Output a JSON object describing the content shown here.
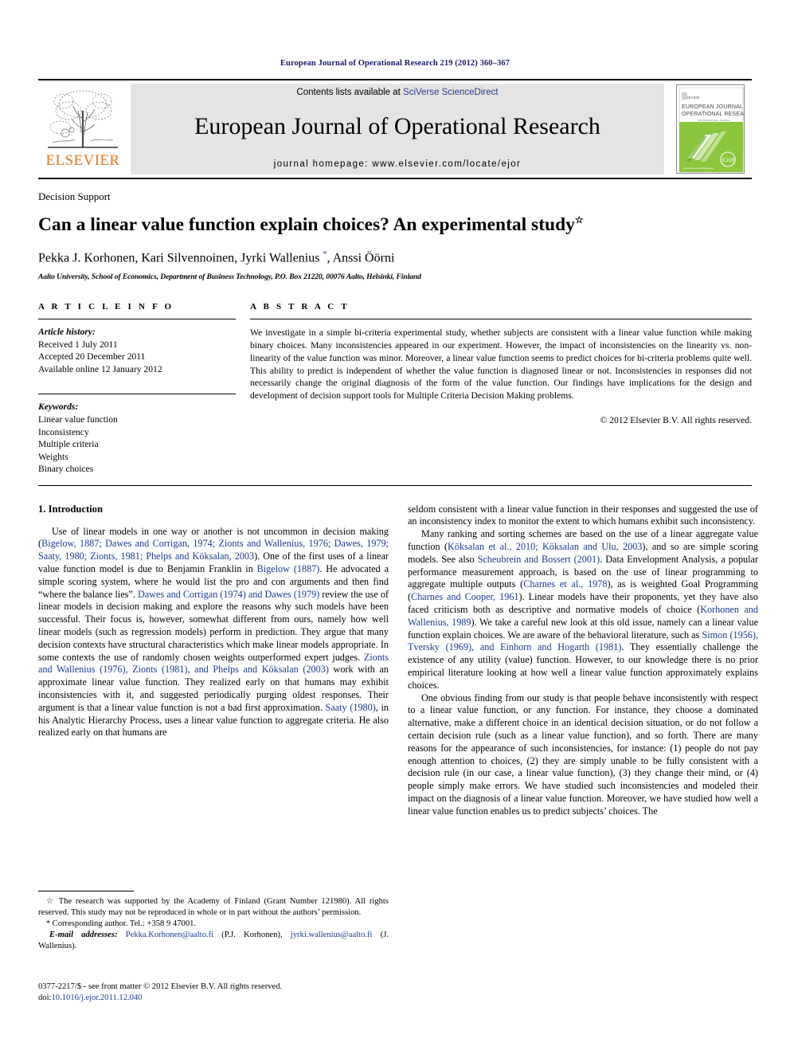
{
  "running_head": "European Journal of Operational Research 219 (2012) 360–367",
  "masthead": {
    "publisher_logo_label": "ELSEVIER",
    "contents_prefix": "Contents lists available at ",
    "contents_link": "SciVerse ScienceDirect",
    "journal_title": "European Journal of Operational Research",
    "homepage_line": "journal homepage: www.elsevier.com/locate/ejor",
    "cover_title_line1": "EUROPEAN  JOURNAL  OF",
    "cover_title_line2": "OPERATIONAL  RESEARCH",
    "cover_url": "www.elsevier.com/locate/ejor",
    "cover_badge": "EJOR",
    "accent_green": "#8cc63e",
    "accent_orange": "#E87722",
    "link_blue": "#1a3a8f"
  },
  "article": {
    "section_tag": "Decision Support",
    "title": "Can a linear value function explain choices? An experimental study",
    "title_mark": "☆",
    "authors": "Pekka J. Korhonen, Kari Silvennoinen, Jyrki Wallenius ",
    "corresponding_mark": "*",
    "authors_tail": ", Anssi Öörni",
    "affiliation": "Aalto University, School of Economics, Department of Business Technology, P.O. Box 21220, 00076 Aalto, Helsinki, Finland"
  },
  "article_info": {
    "heading": "A R T I C L E  I N F O",
    "history_label": "Article history:",
    "history": [
      "Received 1 July 2011",
      "Accepted 20 December 2011",
      "Available online 12 January 2012"
    ],
    "keywords_label": "Keywords:",
    "keywords": [
      "Linear value function",
      "Inconsistency",
      "Multiple criteria",
      "Weights",
      "Binary choices"
    ]
  },
  "abstract": {
    "heading": "A B S T R A C T",
    "text": "We investigate in a simple bi-criteria experimental study, whether subjects are consistent with a linear value function while making binary choices. Many inconsistencies appeared in our experiment. However, the impact of inconsistencies on the linearity vs. non-linearity of the value function was minor. Moreover, a linear value function seems to predict choices for bi-criteria problems quite well. This ability to predict is independent of whether the value function is diagnosed linear or not. Inconsistencies in responses did not necessarily change the original diagnosis of the form of the value function. Our findings have implications for the design and development of decision support tools for Multiple Criteria Decision Making problems.",
    "copyright": "© 2012 Elsevier B.V. All rights reserved."
  },
  "body": {
    "section_number_title": "1. Introduction",
    "left_paragraphs": [
      "Use of linear models in one way or another is not uncommon in decision making (<a class=\"ref\">Bigelow, 1887; Dawes and Corrigan, 1974; Zionts and Wallenius, 1976; Dawes, 1979; Saaty, 1980; Zionts, 1981; Phelps and Köksalan, 2003</a>). One of the first uses of a linear value function model is due to Benjamin Franklin in <a class=\"ref\">Bigelow (1887)</a>. He advocated a simple scoring system, where he would list the pro and con arguments and then find “where the balance lies”. <a class=\"ref\">Dawes and Corrigan (1974) and Dawes (1979)</a> review the use of linear models in decision making and explore the reasons why such models have been successful. Their focus is, however, somewhat different from ours, namely how well linear models (such as regression models) perform in prediction. They argue that many decision contexts have structural characteristics which make linear models appropriate. In some contexts the use of randomly chosen weights outperformed expert judges. <a class=\"ref\">Zionts and Wallenius (1976), Zionts (1981), and Phelps and Köksalan (2003)</a> work with an approximate linear value function. They realized early on that humans may exhibit inconsistencies with it, and suggested periodically purging oldest responses. Their argument is that a linear value function is not a bad first approximation. <a class=\"ref\">Saaty (1980)</a>, in his Analytic Hierarchy Process, uses a linear value function to aggregate criteria. He also realized early on that humans are"
    ],
    "right_paragraphs": [
      "seldom consistent with a linear value function in their responses and suggested the use of an inconsistency index to monitor the extent to which humans exhibit such inconsistency.",
      "Many ranking and sorting schemes are based on the use of a linear aggregate value function (<a class=\"ref\">Köksalan et al., 2010; Köksalan and Ulu, 2003</a>), and so are simple scoring models. See also <a class=\"ref\">Scheubrein and Bossert (2001)</a>. Data Envelopment Analysis, a popular performance measurement approach, is based on the use of linear programming to aggregate multiple outputs (<a class=\"ref\">Charnes et al., 1978</a>), as is weighted Goal Programming (<a class=\"ref\">Charnes and Cooper, 1961</a>). Linear models have their proponents, yet they have also faced criticism both as descriptive and normative models of choice (<a class=\"ref\">Korhonen and Wallenius, 1989</a>). We take a careful new look at this old issue, namely can a linear value function explain choices. We are aware of the behavioral literature, such as <a class=\"ref\">Simon (1956), Tversky (1969), and Einhorn and Hogarth (1981)</a>. They essentially challenge the existence of any utility (value) function. However, to our knowledge there is no prior empirical literature looking at how well a linear value function approximately explains choices.",
      "One obvious finding from our study is that people behave inconsistently with respect to a linear value function, or any function. For instance, they choose a dominated alternative, make a different choice in an identical decision situation, or do not follow a certain decision rule (such as a linear value function), and so forth. There are many reasons for the appearance of such inconsistencies, for instance: (1) people do not pay enough attention to choices, (2) they are simply unable to be fully consistent with a decision rule (in our case, a linear value function), (3) they change their mind, or (4) people simply make errors. We have studied such inconsistencies and modeled their impact on the diagnosis of a linear value function. Moreover, we have studied how well a linear value function enables us to predict subjects’ choices. The"
    ]
  },
  "footnotes": {
    "funding_symbol": "☆",
    "funding": "The research was supported by the Academy of Finland (Grant Number 121980). All rights reserved. This study may not be reproduced in whole or in part without the authors’ permission.",
    "corresponding_symbol": "*",
    "corresponding": "Corresponding author. Tel.: +358 9 47001.",
    "email_label": "E-mail addresses:",
    "email_1": "Pekka.Korhonen@aalto.fi",
    "email_1_owner": "(P.J. Korhonen)",
    "email_2": "jyrki.wallenius@aalto.fi",
    "email_2_owner": "(J. Wallenius)"
  },
  "imprint": {
    "issn_line": "0377-2217/$ - see front matter © 2012 Elsevier B.V. All rights reserved.",
    "doi_label": "doi:",
    "doi_value": "10.1016/j.ejor.2011.12.040"
  }
}
